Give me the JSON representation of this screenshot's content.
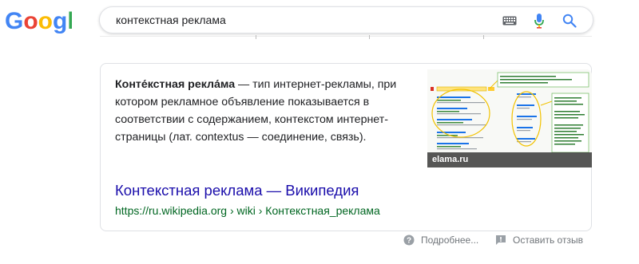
{
  "logo": {
    "text": "Google"
  },
  "search": {
    "query": "контекстная реклама",
    "keyboard_icon": "keyboard-icon",
    "mic_icon": "microphone-icon",
    "search_icon": "search-icon"
  },
  "snippet": {
    "term": "Конте́кстная рекла́ма",
    "description": " — тип интернет-рекламы, при котором рекламное объявление показывается в соответствии с содержанием, контекстом интернет-страницы (лат. contextus — соединение, связь).",
    "image_caption": "elama.ru",
    "result_title": "Контекстная реклама — Википедия",
    "result_url": "https://ru.wikipedia.org › wiki › Контекстная_реклама"
  },
  "footer": {
    "more_label": "Подробнее...",
    "feedback_label": "Оставить отзыв"
  },
  "colors": {
    "link": "#1a0dab",
    "url": "#006621",
    "muted": "#70757a"
  }
}
